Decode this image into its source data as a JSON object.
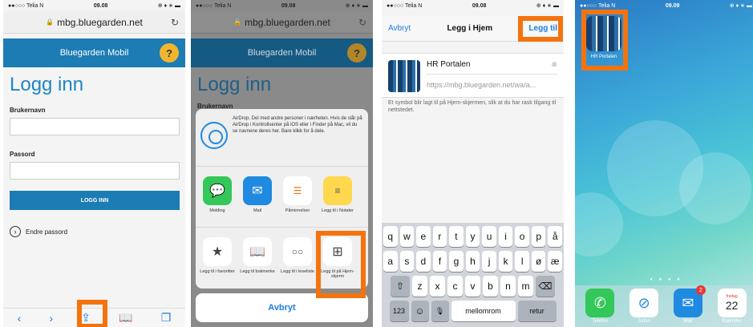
{
  "panel1": {
    "status": {
      "carrier": "●●○○○ Telia N",
      "time": "09.08",
      "right": "⊕ ♦ ∗ ▬"
    },
    "url": "mbg.bluegarden.net",
    "header_title": "Bluegarden Mobil",
    "help": "?",
    "page_title": "Logg inn",
    "username_label": "Brukernavn",
    "password_label": "Passord",
    "login_button": "LOGG INN",
    "change_password": "Endre passord"
  },
  "panel2": {
    "status": {
      "carrier": "●●○○○ Telia N",
      "time": "09.08",
      "right": "⊕ ♦ ∗ ▬"
    },
    "url": "mbg.bluegarden.net",
    "header_title": "Bluegarden Mobil",
    "help": "?",
    "page_title": "Logg inn",
    "partial_label": "Brukernavn",
    "airdrop_text": "AirDrop. Del med andre personer i nærheten. Hvis de slår på AirDrop i Kontrollsenter på iOS eller i Finder på Mac, vil du se navnene deres her. Bare klikk for å dele.",
    "share_apps": [
      {
        "label": "Melding",
        "icon": "message-icon",
        "color": "#34c759"
      },
      {
        "label": "Mail",
        "icon": "mail-icon",
        "color": "#1f8ae0"
      },
      {
        "label": "Påminnelser",
        "icon": "reminders-icon",
        "color": "#ffffff"
      },
      {
        "label": "Legg til i Notater",
        "icon": "notes-icon",
        "color": "#ffd84d"
      }
    ],
    "actions": [
      {
        "label": "Legg til i favoritter",
        "icon": "star-icon"
      },
      {
        "label": "Legg til bokmerke",
        "icon": "book-icon"
      },
      {
        "label": "Legg til i leseliste",
        "icon": "glasses-icon"
      },
      {
        "label": "Legg til på Hjem-skjerm",
        "icon": "plus-icon"
      }
    ],
    "cancel": "Avbryt"
  },
  "panel3": {
    "status": {
      "carrier": "●●○○○ Telia N",
      "time": "09.08",
      "right": "⊕ ♦ ∗ ▬"
    },
    "cancel": "Avbryt",
    "title": "Legg i Hjem",
    "add": "Legg til",
    "app_name": "HR Portalen",
    "app_url": "https://mbg.bluegarden.net/wa/a...",
    "description": "Et symbol blir lagt til på Hjem-skjermen, slik at du har rask tilgang til nettstedet.",
    "keyboard": {
      "row1": [
        "q",
        "w",
        "e",
        "r",
        "t",
        "y",
        "u",
        "i",
        "o",
        "p",
        "å"
      ],
      "row2": [
        "a",
        "s",
        "d",
        "f",
        "g",
        "h",
        "j",
        "k",
        "l",
        "ø",
        "æ"
      ],
      "row3": [
        "z",
        "x",
        "c",
        "v",
        "b",
        "n",
        "m"
      ],
      "shift": "⇧",
      "backspace": "⌫",
      "numbers": "123",
      "emoji": "☺",
      "mic": "🎙",
      "space": "mellomrom",
      "return": "retur"
    }
  },
  "panel4": {
    "status": {
      "carrier": "●●○○○ Telia N",
      "time": "09.09",
      "right": "⊕ ♦ ∗ ▬"
    },
    "icon_label": "HR Portalen",
    "dock": [
      {
        "label": "Telefon",
        "icon": "phone-icon",
        "color": "#34c759",
        "glyph": "✆"
      },
      {
        "label": "Safari",
        "icon": "safari-icon",
        "color": "#1f8ae0",
        "glyph": "⊘"
      },
      {
        "label": "Mail",
        "icon": "mail-icon",
        "color": "#1f8ae0",
        "glyph": "✉",
        "badge": "2"
      },
      {
        "label": "Kalender",
        "icon": "calendar-icon",
        "color": "#ffffff",
        "glyph": "22",
        "sub": "fredag"
      }
    ]
  }
}
